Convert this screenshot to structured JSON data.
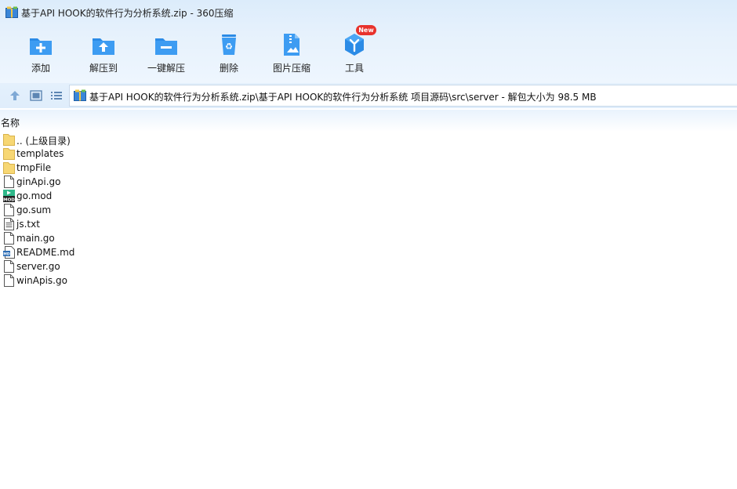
{
  "window": {
    "title": "基于API HOOK的软件行为分析系统.zip - 360压缩"
  },
  "toolbar": {
    "items": [
      {
        "label": "添加",
        "icon": "add-folder-icon"
      },
      {
        "label": "解压到",
        "icon": "extract-to-icon"
      },
      {
        "label": "一键解压",
        "icon": "one-click-extract-icon"
      },
      {
        "label": "删除",
        "icon": "recycle-bin-icon"
      },
      {
        "label": "图片压缩",
        "icon": "image-compress-icon"
      },
      {
        "label": "工具",
        "icon": "tools-cube-icon"
      }
    ],
    "badge": "New"
  },
  "address": {
    "path": "基于API HOOK的软件行为分析系统.zip\\基于API HOOK的软件行为分析系统 项目源码\\src\\server - 解包大小为 98.5 MB"
  },
  "columns": {
    "name": "名称"
  },
  "files": [
    {
      "name": ".. (上级目录)",
      "type": "folder"
    },
    {
      "name": "templates",
      "type": "folder"
    },
    {
      "name": "tmpFile",
      "type": "folder"
    },
    {
      "name": "ginApi.go",
      "type": "file"
    },
    {
      "name": "go.mod",
      "type": "mod"
    },
    {
      "name": "go.sum",
      "type": "file"
    },
    {
      "name": "js.txt",
      "type": "text"
    },
    {
      "name": "main.go",
      "type": "file"
    },
    {
      "name": "README.md",
      "type": "markdown"
    },
    {
      "name": "server.go",
      "type": "file"
    },
    {
      "name": "winApis.go",
      "type": "file"
    }
  ],
  "colors": {
    "accent": "#2b8be6",
    "toolbar_bg": "#e6f1fc",
    "folder": "#f7d774",
    "badge": "#e8322c"
  }
}
